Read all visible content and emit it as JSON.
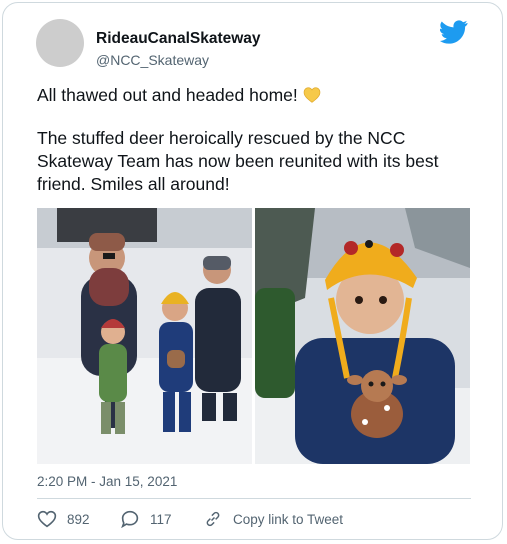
{
  "tweet": {
    "author_name": "RideauCanalSkateway",
    "author_handle": "@NCC_Skateway",
    "line1": "All thawed out and headed home!",
    "line2": "The stuffed deer heroically rescued by the NCC Skateway Team has now been reunited with its best friend. Smiles all around!",
    "timestamp": "2:20 PM - Jan 15, 2021",
    "likes": "892",
    "replies": "117",
    "copy_link_label": "Copy link to Tweet"
  },
  "icons": {
    "brand": "twitter-bird-icon",
    "emoji": "yellow-heart-emoji",
    "like": "heart-icon",
    "reply": "speech-bubble-icon",
    "link": "link-icon"
  },
  "colors": {
    "twitter_blue": "#1d9bf0",
    "text_primary": "#0f1419",
    "text_secondary": "#536471",
    "border": "#cfd9de"
  }
}
